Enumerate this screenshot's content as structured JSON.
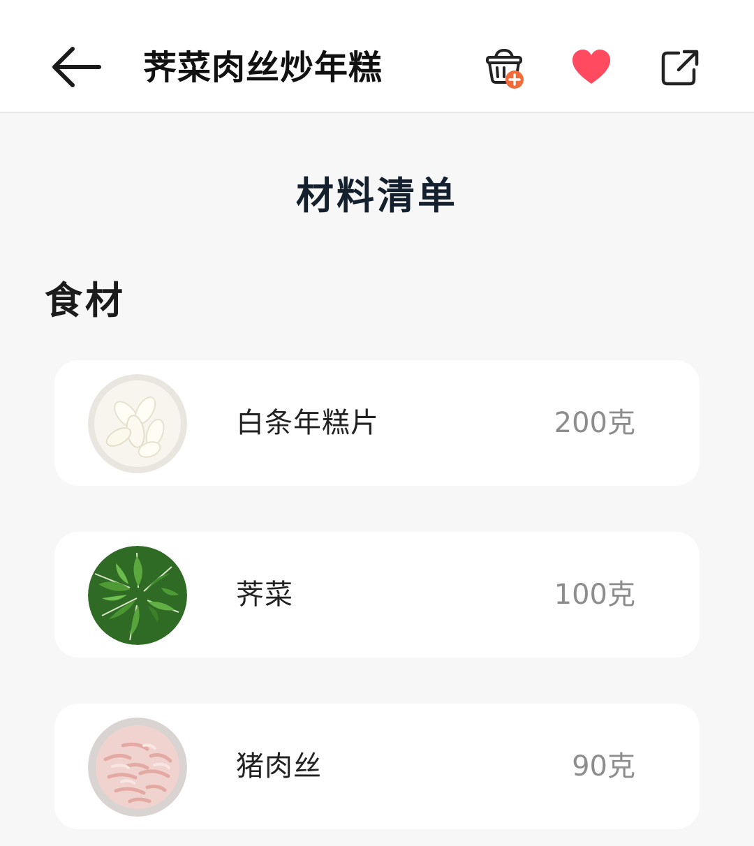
{
  "header": {
    "title": "荠菜肉丝炒年糕",
    "icons": {
      "back": "arrow-left-icon",
      "basket": "basket-add-icon",
      "favorite": "heart-icon",
      "share": "share-external-icon"
    }
  },
  "materials": {
    "title": "材料清单",
    "section_label": "食材",
    "ingredients": [
      {
        "name": "白条年糕片",
        "amount": "200克"
      },
      {
        "name": "荠菜",
        "amount": "100克"
      },
      {
        "name": "猪肉丝",
        "amount": "90克"
      }
    ]
  },
  "colors": {
    "heart": "#ff4a5f",
    "basket_badge": "#f36b3b",
    "title_text": "#14202e",
    "amount_text": "#8d8d8d",
    "background": "#f7f7f7",
    "card": "#ffffff"
  }
}
